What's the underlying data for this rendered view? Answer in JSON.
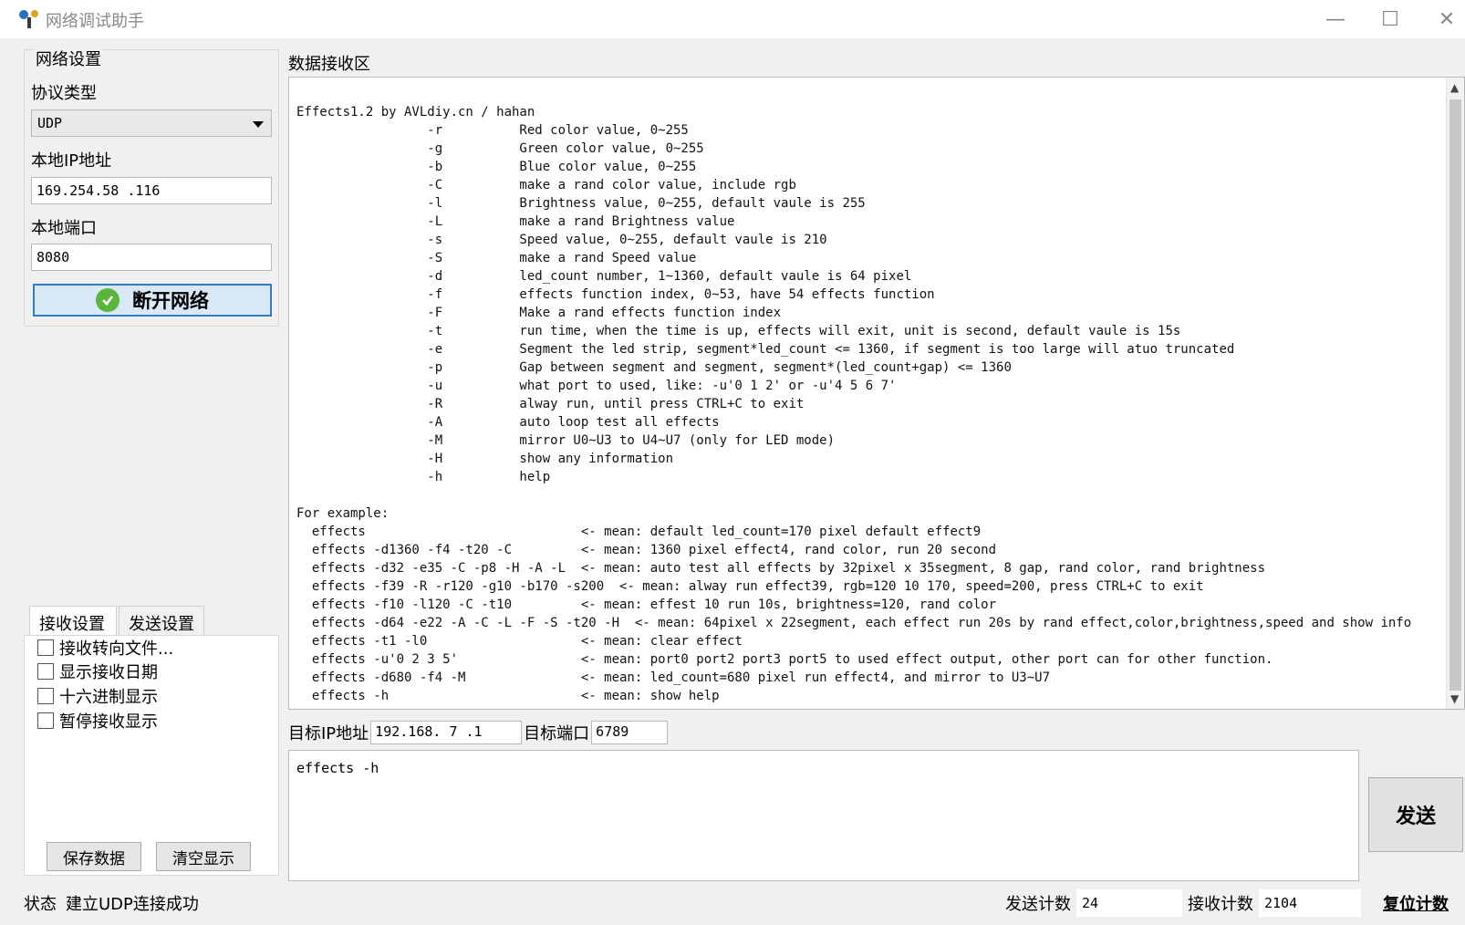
{
  "window": {
    "title": "网络调试助手",
    "min_glyph": "—",
    "max_glyph": "☐",
    "close_glyph": "✕"
  },
  "net_settings": {
    "legend": "网络设置",
    "protocol_label": "协议类型",
    "protocol_value": "UDP",
    "local_ip_label": "本地IP地址",
    "local_ip_value": "169.254.58 .116",
    "local_port_label": "本地端口",
    "local_port_value": "8080",
    "connect_button": "断开网络"
  },
  "tabs": {
    "recv_settings": "接收设置",
    "send_settings": "发送设置"
  },
  "recv_options": [
    {
      "label": "接收转向文件...",
      "checked": false
    },
    {
      "label": "显示接收日期",
      "checked": false
    },
    {
      "label": "十六进制显示",
      "checked": false
    },
    {
      "label": "暂停接收显示",
      "checked": false
    }
  ],
  "buttons": {
    "save_data": "保存数据",
    "clear_display": "清空显示",
    "send": "发送"
  },
  "receive": {
    "label": "数据接收区",
    "text": "Effects1.2 by AVLdiy.cn / hahan\n                 -r          Red color value, 0~255\n                 -g          Green color value, 0~255\n                 -b          Blue color value, 0~255\n                 -C          make a rand color value, include rgb\n                 -l          Brightness value, 0~255, default vaule is 255\n                 -L          make a rand Brightness value\n                 -s          Speed value, 0~255, default vaule is 210\n                 -S          make a rand Speed value\n                 -d          led_count number, 1~1360, default vaule is 64 pixel\n                 -f          effects function index, 0~53, have 54 effects function\n                 -F          Make a rand effects function index\n                 -t          run time, when the time is up, effects will exit, unit is second, default vaule is 15s\n                 -e          Segment the led strip, segment*led_count <= 1360, if segment is too large will atuo truncated\n                 -p          Gap between segment and segment, segment*(led_count+gap) <= 1360\n                 -u          what port to used, like: -u'0 1 2' or -u'4 5 6 7'\n                 -R          alway run, until press CTRL+C to exit\n                 -A          auto loop test all effects\n                 -M          mirror U0~U3 to U4~U7 (only for LED mode)\n                 -H          show any information\n                 -h          help\n\nFor example:\n  effects                            <- mean: default led_count=170 pixel default effect9\n  effects -d1360 -f4 -t20 -C         <- mean: 1360 pixel effect4, rand color, run 20 second\n  effects -d32 -e35 -C -p8 -H -A -L  <- mean: auto test all effects by 32pixel x 35segment, 8 gap, rand color, rand brightness\n  effects -f39 -R -r120 -g10 -b170 -s200  <- mean: alway run effect39, rgb=120 10 170, speed=200, press CTRL+C to exit\n  effects -f10 -l120 -C -t10         <- mean: effest 10 run 10s, brightness=120, rand color\n  effects -d64 -e22 -A -C -L -F -S -t20 -H  <- mean: 64pixel x 22segment, each effect run 20s by rand effect,color,brightness,speed and show info\n  effects -t1 -l0                    <- mean: clear effect\n  effects -u'0 2 3 5'                <- mean: port0 port2 port3 port5 to used effect output, other port can for other function.\n  effects -d680 -f4 -M               <- mean: led_count=680 pixel run effect4, and mirror to U3~U7\n  effects -h                         <- mean: show help"
  },
  "target": {
    "ip_label": "目标IP地址",
    "ip_value": "192.168. 7 .1",
    "port_label": "目标端口",
    "port_value": "6789"
  },
  "send": {
    "text": "effects -h"
  },
  "status": {
    "label": "状态",
    "message": "建立UDP连接成功",
    "send_count_label": "发送计数",
    "send_count": "24",
    "recv_count_label": "接收计数",
    "recv_count": "2104",
    "reset_label": "复位计数"
  },
  "colors": {
    "connect_border": "#2f7dc8",
    "connect_bg": "#d8e8f6",
    "check_green": "#5ab63a"
  }
}
